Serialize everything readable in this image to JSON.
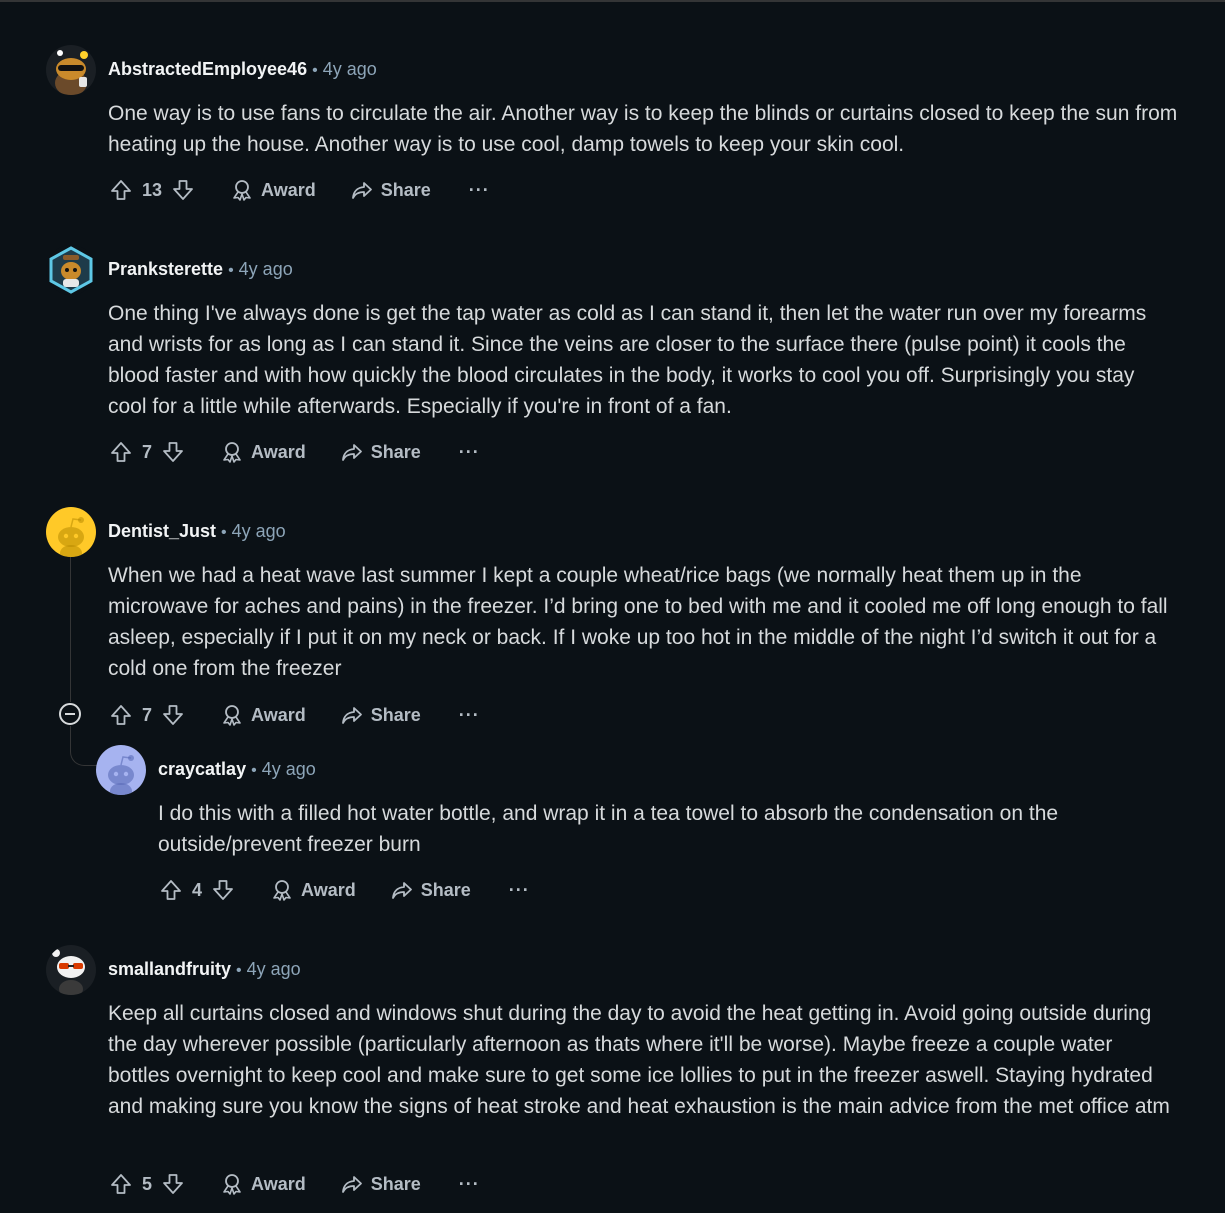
{
  "actions": {
    "award_label": "Award",
    "share_label": "Share",
    "more_label": "···"
  },
  "comments": [
    {
      "author": "AbstractedEmployee46",
      "separator": "•",
      "age": "4y ago",
      "body": "One way is to use fans to circulate the air. Another way is to keep the blinds or curtains closed to keep the sun from heating up the house. Another way is to use cool, damp towels to keep your skin cool.",
      "score": "13",
      "avatar_icon": "snoo-avatar-orange-icon"
    },
    {
      "author": "Pranksterette",
      "separator": "•",
      "age": "4y ago",
      "body": "One thing I've always done is get the tap water as cold as I can stand it, then let the water run over my forearms and wrists for as long as I can stand it. Since the veins are closer to the surface there (pulse point) it cools the blood faster and with how quickly the blood circulates in the body, it works to cool you off. Surprisingly you stay cool for a little while afterwards. Especially if you're in front of a fan.",
      "score": "7",
      "avatar_icon": "snoo-avatar-hexagon-icon"
    },
    {
      "author": "Dentist_Just",
      "separator": "•",
      "age": "4y ago",
      "body": "When we had a heat wave last summer I kept a couple wheat/rice bags (we normally heat them up in the microwave for aches and pains) in the freezer. I’d bring one to bed with me and it cooled me off long enough to fall asleep, especially if I put it on my neck or back. If I woke up too hot in the middle of the night I’d switch it out for a cold one from the freezer",
      "score": "7",
      "avatar_icon": "default-snoo-yellow-icon"
    },
    {
      "author": "craycatlay",
      "separator": "•",
      "age": "4y ago",
      "body": "I do this with a filled hot water bottle, and wrap it in a tea towel to absorb the condensation on the outside/prevent freezer burn",
      "score": "4",
      "avatar_icon": "default-snoo-blue-icon"
    },
    {
      "author": "smallandfruity",
      "separator": "•",
      "age": "4y ago",
      "body": "Keep all curtains closed and windows shut during the day to avoid the heat getting in. Avoid going outside during the day wherever possible (particularly afternoon as thats where it'll be worse). Maybe freeze a couple water bottles overnight to keep cool and make sure to get some ice lollies to put in the freezer aswell. Staying hydrated and making sure you know the signs of heat stroke and heat exhaustion is the main advice from the met office atm",
      "score": "5",
      "avatar_icon": "snoo-avatar-sunglasses-icon"
    }
  ]
}
